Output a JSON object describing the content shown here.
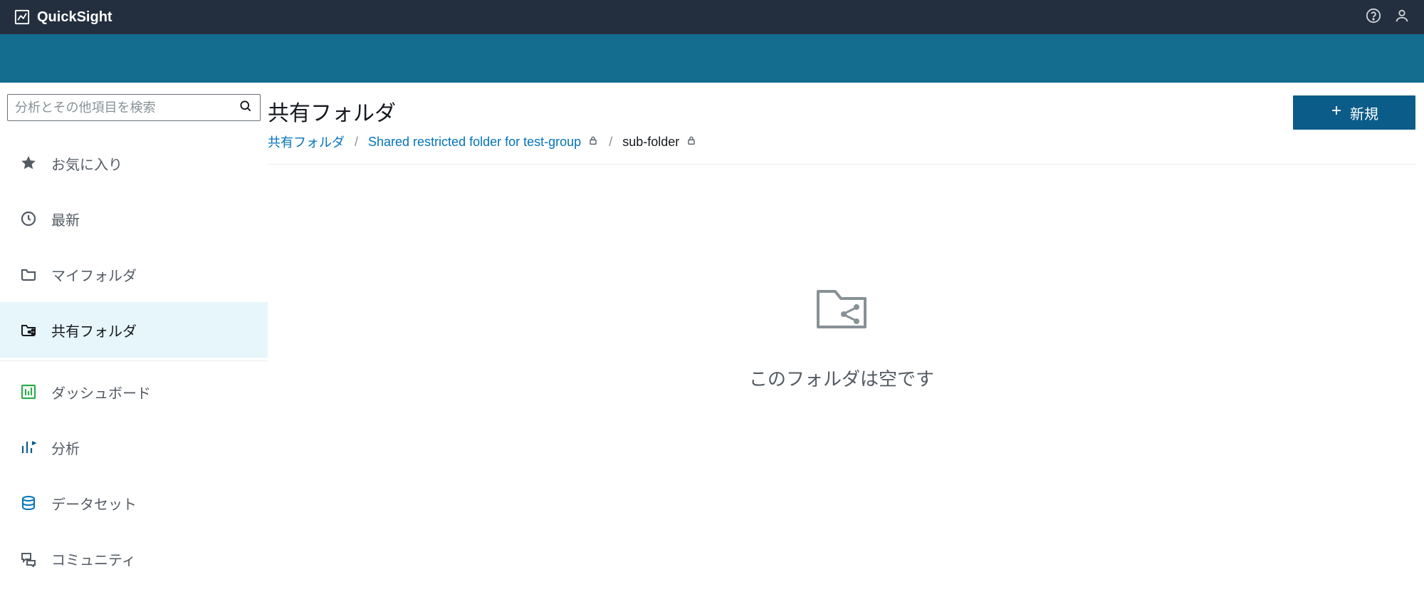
{
  "brand": "QuickSight",
  "search": {
    "placeholder": "分析とその他項目を検索"
  },
  "nav": {
    "favorites": "お気に入り",
    "recent": "最新",
    "my_folders": "マイフォルダ",
    "shared_folders": "共有フォルダ",
    "dashboards": "ダッシュボード",
    "analyses": "分析",
    "datasets": "データセット",
    "community": "コミュニティ"
  },
  "page": {
    "title": "共有フォルダ",
    "new_button": "新規"
  },
  "breadcrumb": {
    "root": "共有フォルダ",
    "parent": "Shared restricted folder for test-group",
    "current": "sub-folder"
  },
  "empty": {
    "message": "このフォルダは空です"
  }
}
